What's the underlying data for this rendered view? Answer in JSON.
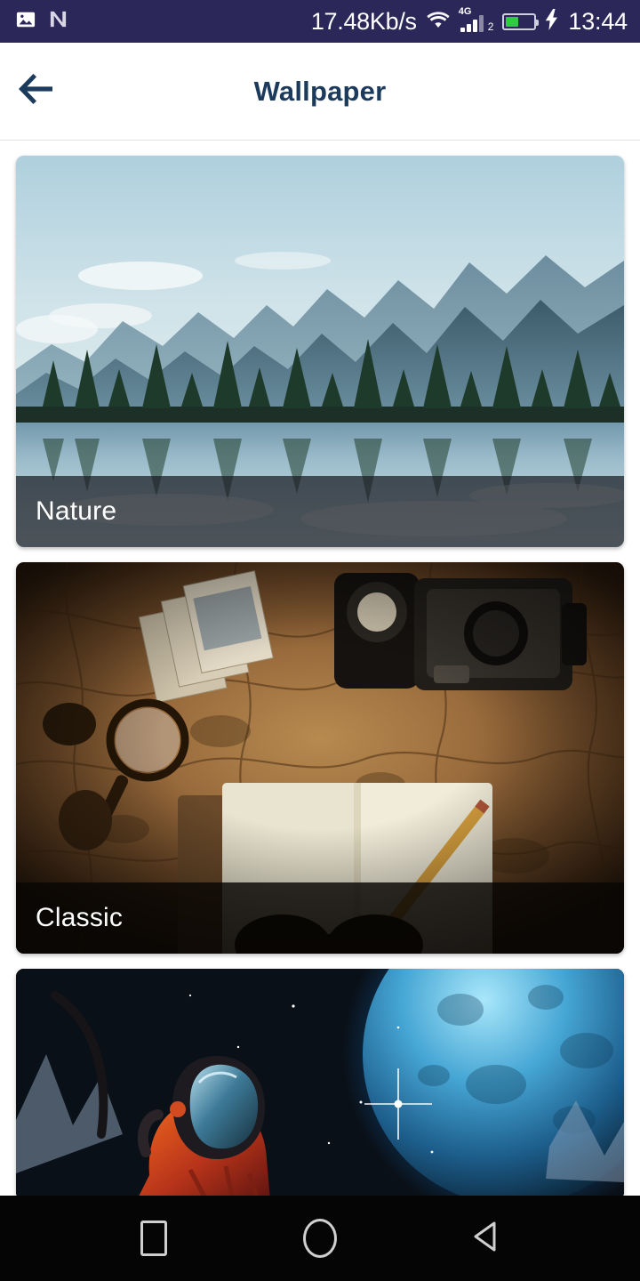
{
  "status_bar": {
    "background": "#2c2759",
    "left_icons": [
      {
        "name": "screenshot-image-icon",
        "glyph": "image"
      },
      {
        "name": "nova-launcher-icon",
        "glyph": "N"
      }
    ],
    "network_speed": "17.48Kb/s",
    "wifi_icon": "wifi-icon",
    "network_type": "4G",
    "sim_slot": "2",
    "battery": {
      "level_percent": 45,
      "fill_color": "#2ecc40",
      "charging": true
    },
    "charging_icon": "lightning-bolt-icon",
    "clock": "13:44"
  },
  "header": {
    "back_icon": "back-arrow-icon",
    "title": "Wallpaper",
    "title_color": "#1b3a5c",
    "background": "#ffffff"
  },
  "wallpaper_list": {
    "items": [
      {
        "label": "Nature",
        "art": "mountain-lake-reflection-photo",
        "caption_style": "slate"
      },
      {
        "label": "Classic",
        "art": "vintage-map-camera-notebook-photo",
        "caption_style": "dark"
      },
      {
        "label": "",
        "art": "astronaut-blue-planet-space-art",
        "caption_style": "none"
      }
    ]
  },
  "nav_bar": {
    "background": "#050505",
    "buttons": [
      {
        "name": "recents-button",
        "icon": "square-icon"
      },
      {
        "name": "home-button",
        "icon": "circle-icon"
      },
      {
        "name": "back-button",
        "icon": "triangle-left-icon"
      }
    ]
  }
}
